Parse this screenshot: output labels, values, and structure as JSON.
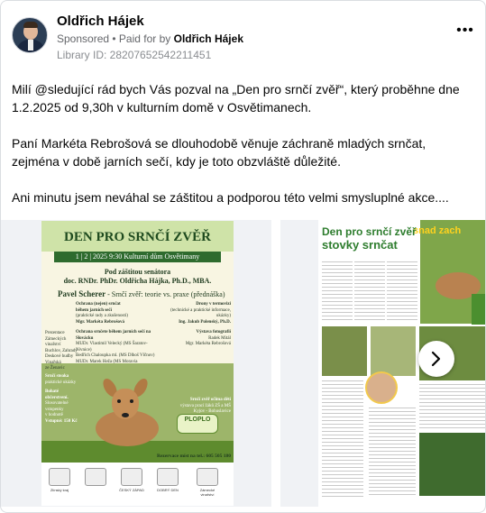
{
  "post": {
    "author_name": "Oldřich Hájek",
    "sponsored_label": "Sponsored",
    "paid_for_prefix": " • Paid for by ",
    "paid_for_name": "Oldřich Hájek",
    "library_id": "Library ID: 28207652542211451",
    "more_label": "•••",
    "paragraphs": [
      "Milí @sledující rád bych Vás pozval na „Den pro srnčí zvěř“, který proběhne dne 1.2.2025 od 9,30h v kulturním domě v Osvětimanech.",
      "Paní Markéta Rebrošová se dlouhodobě věnuje záchraně mladých srnčat, zejména v době jarních sečí, kdy je toto obzvláště důležité.",
      "Ani minutu jsem neváhal se záštitou a podporou této velmi smysluplné akce...."
    ]
  },
  "carousel": {
    "next_icon": "chevron-right-icon",
    "poster": {
      "title": "DEN PRO SRNČÍ ZVĚŘ",
      "date_bar": "1 | 2 | 2025     9:30     Kulturní dům Osvětimany",
      "patronage_line1": "Pod záštitou senátora",
      "patronage_line2": "doc. RNDr. PhDr. Oldřicha Hájka, Ph.D., MBA.",
      "speaker_name": "Pavel Scherer",
      "speaker_topic": " - Srnčí zvěř: teorie vs. praxe",
      "speaker_note": "(přednáška)",
      "col_left": [
        "Ochrana (nejen) srnčat",
        "během jarních sečí",
        "(praktické rady a zkušenosti)",
        "Mgr. Markéta Rebrošová",
        "",
        "Ochrana srnčete během jarních sečí na Slovácku",
        "MUDr. Vlastimil Velecký (MS Šaratov-Nivnice)",
        "Bedřich Chaloupka ml. (MS Dlhoš Vlčnov)",
        "MUDr. Marek Heža (MS Moravia Záhorovice)"
      ],
      "col_right": [
        "Drony v termovizi",
        "(technické a praktické informace, ukázky)",
        "Ing. Jakub Polenský, Ph.D.",
        "",
        "Výstava fotografií",
        "Radek Mitál",
        "Mgr. Markéta Rebrošová"
      ],
      "side_list": [
        "Prezentace",
        "Zámeckých",
        "vinařství",
        "Buchlov, Zahrady",
        "Deskové hudby",
        "Vinařská",
        "ze Ženavic"
      ],
      "side_list2": [
        "Srnčí steaka",
        "praktické ukázky",
        "",
        "Bohaté",
        "občerstvení.",
        "Slosovatelné",
        "vstupenky",
        "v hodnotě",
        "Vstupné: 150 Kč"
      ],
      "raffle_lines": [
        "Srnčí zvěř očima dětí",
        "výstava prací žáků ZŠ a MŠ",
        "Kyjov - Bohuslavice"
      ],
      "brand_logo": "PLOPLO",
      "phone": "Rezervace míst na tel.: 605 505 180",
      "logos": [
        "Zlínský kraj",
        "",
        "ČESKÝ ZÁPAD",
        "DOBRÝ DEN",
        "Zámecké vinařství"
      ]
    },
    "news": {
      "headline1": "Den pro srnčí zvěř",
      "headline2": "stovky srnčat",
      "photo_title": "snad zach"
    }
  }
}
